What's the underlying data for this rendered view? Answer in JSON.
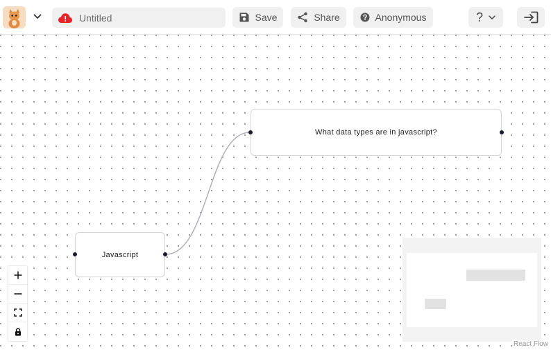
{
  "header": {
    "logo_alt": "Cat avatar logo",
    "title": "Untitled",
    "save_label": "Save",
    "share_label": "Share",
    "user_label": "Anonymous",
    "help_label": "?"
  },
  "nodes": [
    {
      "id": "node-question",
      "label": "What data types are in javascript?"
    },
    {
      "id": "node-root",
      "label": "Javascript"
    }
  ],
  "attribution": "React Flow",
  "colors": {
    "accent_cloud": "#e5252a",
    "handle": "#1a1a2e",
    "edge": "#b1b1b7"
  }
}
